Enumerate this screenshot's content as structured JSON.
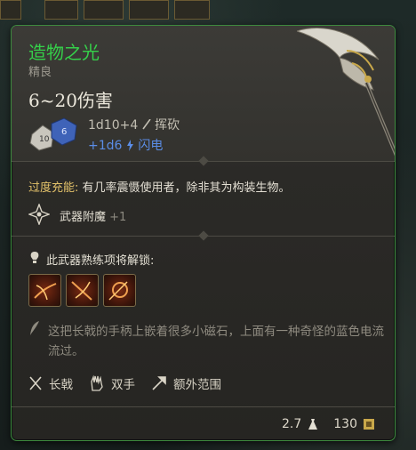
{
  "item": {
    "name": "造物之光",
    "rarity": "精良",
    "damage": "6~20伤害",
    "dice_primary": "1d10+4",
    "damage_type_primary": "挥砍",
    "dice_secondary": "+1d6",
    "damage_type_secondary": "闪电",
    "passive_label": "过度充能:",
    "passive_text": " 有几率震慑使用者，除非其为构装生物。",
    "enchant_label": "武器附魔",
    "enchant_value": "+1",
    "proficiency_text": "此武器熟练项将解锁:",
    "description": "这把长戟的手柄上嵌着很多小磁石，上面有一种奇怪的蓝色电流流过。",
    "properties": [
      "长戟",
      "双手",
      "额外范围"
    ],
    "weight": "2.7",
    "value": "130"
  },
  "colors": {
    "name": "#35d04a",
    "border": "#3e8a3e",
    "gold": "#e3c26a",
    "lightning": "#5b8de6"
  },
  "icons": [
    "dice-icon",
    "slashing-icon",
    "lightning-icon",
    "enchant-icon",
    "proficiency-icon",
    "action-icon",
    "quill-icon",
    "halberd-icon",
    "two-handed-icon",
    "reach-icon",
    "weight-icon",
    "gold-icon"
  ]
}
